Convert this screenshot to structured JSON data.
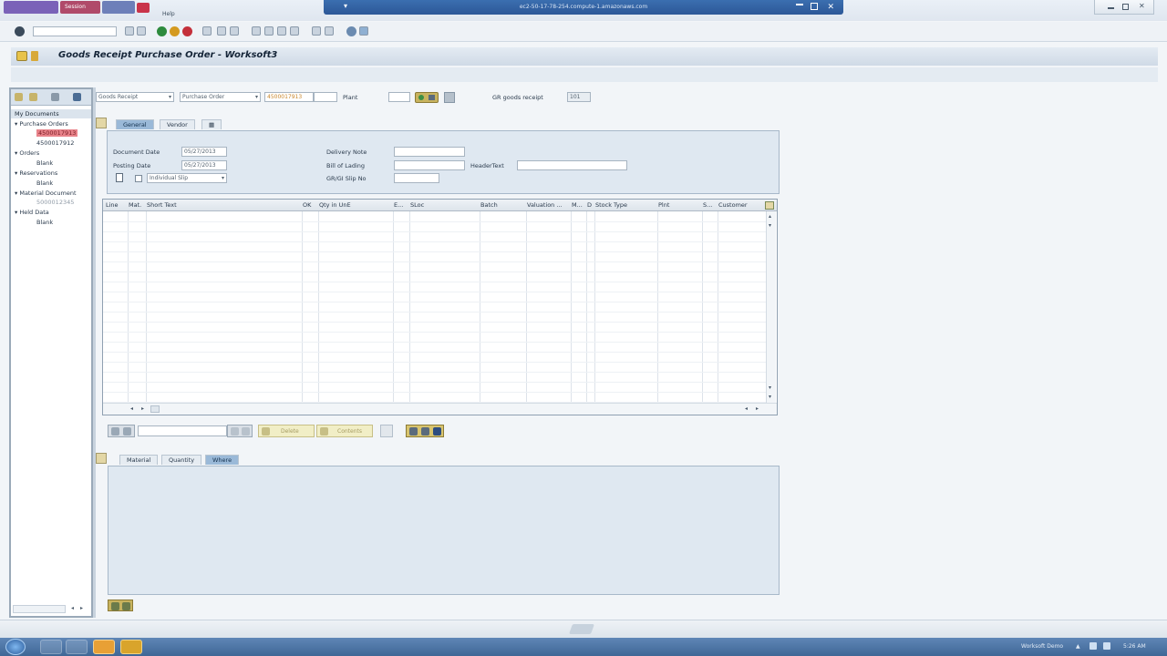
{
  "rdp": {
    "tabs": [
      "",
      "Session"
    ],
    "title": "ec2-50-17-78-254.compute-1.amazonaws.com",
    "menu_help": "Help"
  },
  "toolbar": {
    "command_field_value": ""
  },
  "title": "Goods Receipt Purchase Order - Worksoft3",
  "left_panel": {
    "header": "My Documents",
    "tree": [
      {
        "label": "Purchase Orders",
        "children": [
          "4500017913",
          "4500017912"
        ]
      },
      {
        "label": "Orders",
        "children": [
          "Blank"
        ]
      },
      {
        "label": "Reservations",
        "children": [
          "Blank"
        ]
      },
      {
        "label": "Material Document",
        "children": [
          "5000012345"
        ]
      },
      {
        "label": "Held Data",
        "children": [
          "Blank"
        ]
      }
    ]
  },
  "header_row": {
    "transaction": "Goods Receipt",
    "reference": "Purchase Order",
    "po_number": "4500017913",
    "plant_label": "Plant",
    "plant_value": "",
    "movement_label": "GR goods receipt",
    "movement_value": "101"
  },
  "tabs_top": [
    "General",
    "Vendor"
  ],
  "general": {
    "document_date_label": "Document Date",
    "document_date": "05/27/2013",
    "posting_date_label": "Posting Date",
    "posting_date": "05/27/2013",
    "slip_option": "Individual Slip",
    "delivery_note_label": "Delivery Note",
    "bill_of_lading_label": "Bill of Lading",
    "header_text_label": "HeaderText",
    "slip_no_label": "GR/GI Slip No"
  },
  "grid": {
    "columns": [
      "Line",
      "Mat.",
      "Short Text",
      "OK",
      "Qty in UnE",
      "E...",
      "SLoc",
      "Batch",
      "Valuation ...",
      "M...",
      "D",
      "Stock Type",
      "Plnt",
      "S...",
      "Customer"
    ]
  },
  "actions": {
    "delete_label": "Delete",
    "contents_label": "Contents"
  },
  "tabs_bottom": [
    "Material",
    "Quantity",
    "Where"
  ],
  "taskbar": {
    "tray_label": "Worksoft Demo",
    "time": "5:26 AM"
  },
  "colors": {
    "accent": "#9ab9d8",
    "selected_item": "#e8838a",
    "taskbar": "#4f76a6"
  }
}
